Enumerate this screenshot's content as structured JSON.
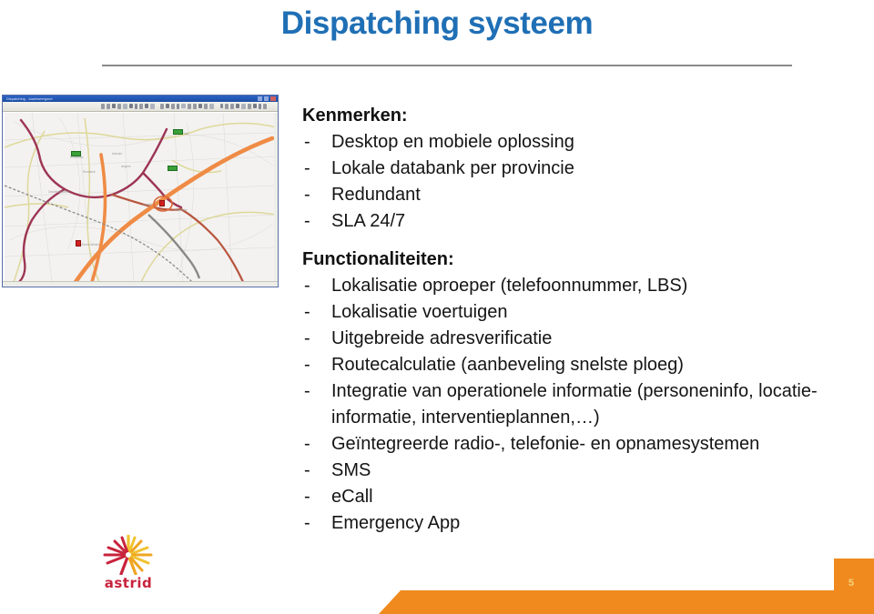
{
  "slide": {
    "title": "Dispatching systeem",
    "page_number": "5",
    "accent_blue": "#1F6FB5",
    "accent_orange": "#F08A1E",
    "page_number_color": "#F6D37A"
  },
  "figure": {
    "name": "dispatching-map-application-screenshot",
    "window_title": "Dispatching - kaartweergave",
    "description": "Screenshot of a mapping application window showing a road network with green vehicle markers and a red incident marker"
  },
  "content": {
    "kenmerken": {
      "heading": "Kenmerken:",
      "items": [
        "Desktop en mobiele oplossing",
        "Lokale databank per provincie",
        "Redundant",
        "SLA 24/7"
      ]
    },
    "functionaliteiten": {
      "heading": "Functionaliteiten:",
      "items": [
        "Lokalisatie oproeper (telefoonnummer, LBS)",
        "Lokalisatie voertuigen",
        "Uitgebreide adresverificatie",
        "Routecalculatie (aanbeveling snelste ploeg)",
        "Integratie van operationele informatie (personeninfo, locatie-informatie, interventieplannen,…)",
        "Geïntegreerde radio-, telefonie- en opnamesystemen",
        "SMS",
        "eCall",
        "Emergency App"
      ]
    },
    "bullet_marker": "-"
  },
  "logo": {
    "wordmark": "astrid",
    "wordmark_color": "#c8233c"
  }
}
